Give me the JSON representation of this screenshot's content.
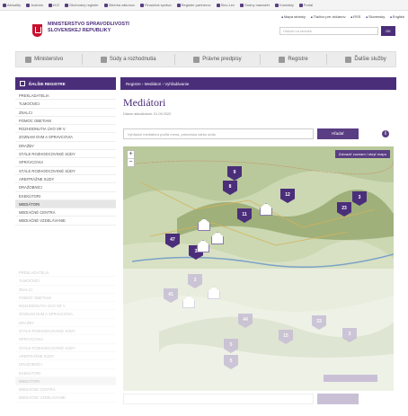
{
  "bookmarks": [
    "Aktuality",
    "Justícia",
    "eVZ",
    "Obchodný register",
    "Zbierka zákonov",
    "Finančná správa",
    "Register partnerov",
    "Slov-Lex",
    "Súdny manažér",
    "Kontakty",
    "Portál"
  ],
  "header": {
    "logo_text": "MINISTERSTVO SPRAVODLIVOSTI SLOVENSKEJ REPUBLIKY",
    "toplinks": [
      "Mapa stránky",
      "Tlačivo pre občanov",
      "RSS",
      "Slovensky",
      "English"
    ],
    "search_placeholder": "Hľadať na stránke",
    "search_button": "OK"
  },
  "mainnav": [
    "Ministerstvo",
    "Súdy a rozhodnutia",
    "Právne predpisy",
    "Registre",
    "Ďalšie služby"
  ],
  "sidebar": {
    "heading": "ĎALŠIE REGISTRE",
    "items": [
      "Prekladatelia",
      "Tlmočníci",
      "Znalci",
      "Pomoc obetiam",
      "Rozhodnutia ÚVO SR V",
      "Zoznam OVM a spravcovia",
      "Dražby",
      "Stále rozhodcovské súdy",
      "Správcovia",
      "Stále rozhodcovské súdy",
      "Arbitrážne súdy",
      "Dražobníci",
      "Exekútori",
      "Mediátori",
      "Mediačné centrá",
      "Mediačné vzdelávanie"
    ],
    "active_index": 13
  },
  "content": {
    "breadcrumb": "Registre › Mediátori › Vyhľadávanie",
    "title": "Mediátori",
    "updated": "Dátum aktualizácie: 01.09.2022",
    "filter_placeholder": "Vyhľadať mediátora podľa mena, priezviska alebo sídla",
    "filter_button": "Hľadať",
    "info_icon": "info-icon",
    "map_toggle": "Zobraziť zoznam / skryť mapu",
    "zoom_in": "+",
    "zoom_out": "−"
  },
  "map_pins": [
    "9",
    "8",
    "12",
    "11",
    "23",
    "3",
    "47",
    "3"
  ],
  "fade_pins": [
    "41",
    "3",
    "44",
    "33",
    "15",
    "3",
    "5",
    "5"
  ],
  "colors": {
    "brand": "#4b2e7a",
    "map_base": "#cbd8b2",
    "map_mountain": "#9fb07a"
  }
}
